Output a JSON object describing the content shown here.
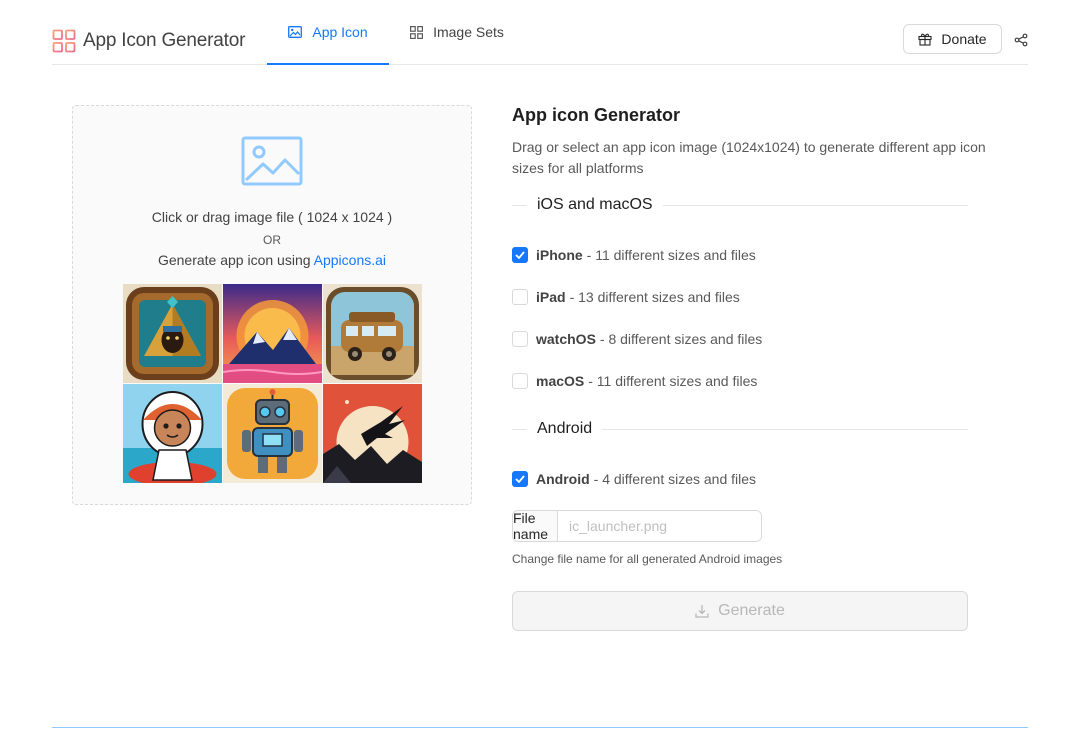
{
  "header": {
    "brand_title": "App Icon Generator",
    "tabs": [
      {
        "label": "App Icon",
        "active": true,
        "icon": "picture-icon"
      },
      {
        "label": "Image Sets",
        "active": false,
        "icon": "grid-icon"
      }
    ],
    "donate_label": "Donate",
    "donate_icon": "gift-icon",
    "share_icon": "share-icon"
  },
  "dropzone": {
    "icon": "image-upload-icon",
    "line1": "Click or drag image file ( 1024 x 1024 )",
    "or_text": "OR",
    "line2_prefix": "Generate app icon using ",
    "link_label": "Appicons.ai",
    "thumbnails": [
      "pharaoh-icon",
      "mountain-sunset-icon",
      "camper-van-icon",
      "girl-character-icon",
      "robot-icon",
      "eagle-moon-icon"
    ]
  },
  "panel": {
    "title": "App icon Generator",
    "description": "Drag or select an app icon image (1024x1024) to generate different app icon sizes for all platforms",
    "sections": [
      {
        "title": "iOS and macOS"
      },
      {
        "title": "Android"
      }
    ],
    "options": [
      {
        "name": "iPhone",
        "detail": "- 11 different sizes and files",
        "checked": true
      },
      {
        "name": "iPad",
        "detail": "- 13 different sizes and files",
        "checked": false
      },
      {
        "name": "watchOS",
        "detail": "- 8 different sizes and files",
        "checked": false
      },
      {
        "name": "macOS",
        "detail": "- 11 different sizes and files",
        "checked": false
      },
      {
        "name": "Android",
        "detail": "- 4 different sizes and files",
        "checked": true
      }
    ],
    "file_name": {
      "addon_label": "File name",
      "placeholder": "ic_launcher.png",
      "value": "",
      "help": "Change file name for all generated Android images"
    },
    "generate_label": "Generate",
    "generate_icon": "download-icon"
  },
  "colors": {
    "accent": "#1677ff",
    "border": "#d9d9d9",
    "footer_line": "#91caff"
  }
}
